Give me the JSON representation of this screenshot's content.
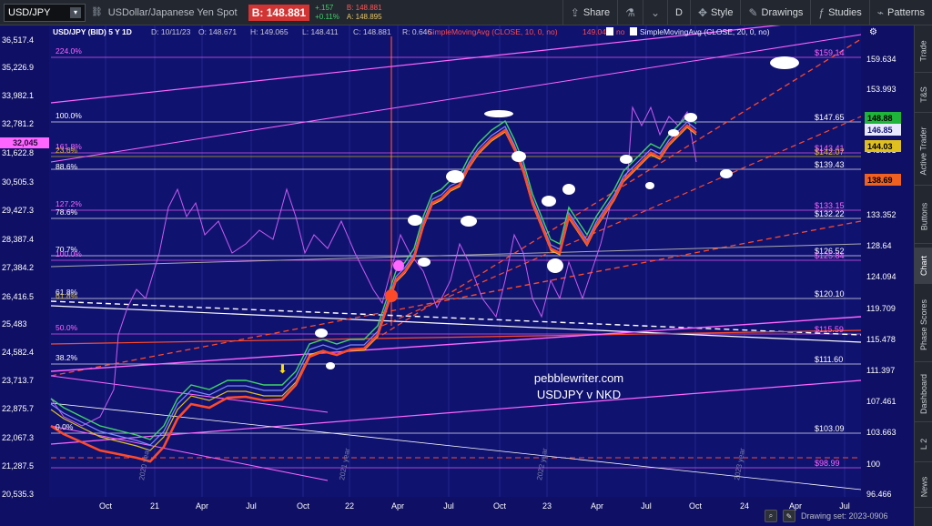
{
  "toolbar": {
    "symbol": "USD/JPY",
    "description": "USDollar/Japanese Yen Spot",
    "bid_label": "B:",
    "bid": "148.881",
    "change": "+.157",
    "change_pct": "+0.11%",
    "b_line": "B: 148.881",
    "a_line": "A: 148.895",
    "buttons": [
      "Share",
      "D",
      "Style",
      "Drawings",
      "Studies",
      "Patterns"
    ],
    "icons": [
      "share-icon",
      "flask-icon",
      "chevron-down-icon",
      "style-icon",
      "pencil-icon",
      "studies-icon",
      "patterns-icon"
    ]
  },
  "chart": {
    "header": "USD/JPY (BID) 5 Y 1D",
    "header_d": "D: 10/11/23",
    "header_o": "O: 148.671",
    "header_h": "H: 149.065",
    "header_l": "L: 148.411",
    "header_c": "C: 148.881",
    "header_r": "R: 0.646",
    "sma10_label": "SimpleMovingAvg (CLOSE, 10, 0, no)",
    "sma10_value": "149.043",
    "sma10_flag": "no",
    "sma20_label": "SimpleMovingAvg (CLOSE, 20, 0, no)",
    "watermark_site": "pebblewriter.com",
    "watermark_title": "USDJPY v NKD",
    "current_left_value": "32,045",
    "left_axis": [
      "36,517.4",
      "35,226.9",
      "33,982.1",
      "32,781.2",
      "31,622.8",
      "30,505.3",
      "29,427.3",
      "28,387.4",
      "27,384.2",
      "26,416.5",
      "25,483",
      "24,582.4",
      "23,713.7",
      "22,875.7",
      "22,067.3",
      "21,287.5",
      "20,535.3"
    ],
    "right_axis": [
      "159.634",
      "153.993",
      "148.551",
      "143.301",
      "138.249",
      "133.352",
      "128.64",
      "124.094",
      "119.709",
      "115.478",
      "111.397",
      "107.461",
      "103.663",
      "100",
      "96.466"
    ],
    "x_axis": [
      "Oct",
      "21",
      "Apr",
      "Jul",
      "Oct",
      "22",
      "Apr",
      "Jul",
      "Oct",
      "23",
      "Apr",
      "Jul",
      "Oct",
      "24",
      "Apr",
      "Jul"
    ],
    "year_marks": [
      "2020 year",
      "2021 year",
      "2022 year",
      "2023 year"
    ],
    "fib_left": [
      "224.0%",
      "100.0%",
      "161.8%",
      "23.6%",
      "88.6%",
      "127.2%",
      "78.6%",
      "70.7%",
      "100.0%",
      "61.8%",
      "61.8%",
      "50.0%",
      "38.2%",
      "0.0%"
    ],
    "fib_right": [
      "$159.14",
      "$147.65",
      "$143.41",
      "$142.07",
      "$139.43",
      "$133.15",
      "$132.22",
      "$126.52",
      "$125.84",
      "$120.10",
      "$115.59",
      "$111.60",
      "$103.09",
      "$98.99"
    ],
    "price_tags": [
      {
        "value": "148.88",
        "color": "#1eb53a"
      },
      {
        "value": "146.85",
        "color": "#e8e8ff"
      },
      {
        "value": "144.03",
        "color": "#e0c020"
      },
      {
        "value": "138.69",
        "color": "#f06020"
      }
    ]
  },
  "sidetabs": [
    "Trade",
    "T&S",
    "Active Trader",
    "Buttons",
    "Chart",
    "Phase Scores",
    "Dashboard",
    "L 2",
    "News"
  ],
  "status": {
    "drawing_set": "Drawing set: 2023-0906"
  }
}
